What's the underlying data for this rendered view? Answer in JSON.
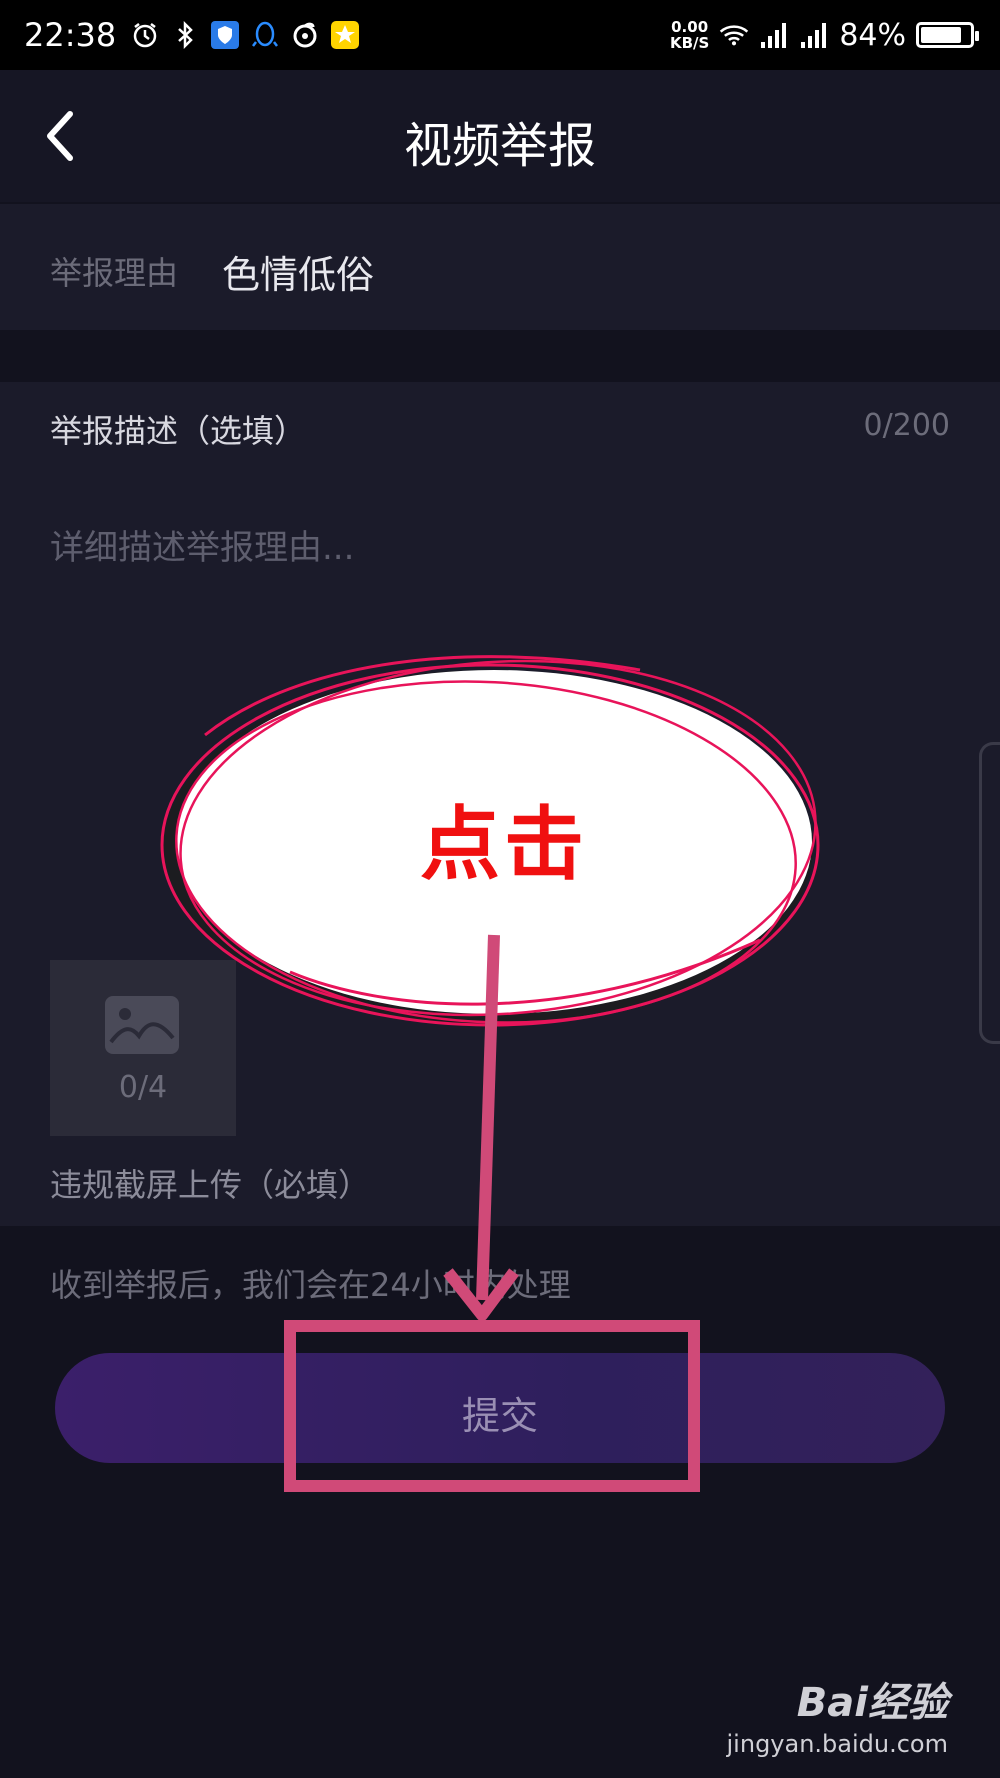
{
  "status_bar": {
    "time": "22:38",
    "net_speed_value": "0.00",
    "net_speed_unit": "KB/S",
    "battery_text": "84%",
    "battery_level": 0.84,
    "icons": [
      "alarm-icon",
      "bluetooth-icon",
      "shield-icon",
      "qq-icon",
      "music-icon",
      "star-icon",
      "wifi-icon",
      "signal-icon",
      "signal-4g-icon",
      "battery-icon"
    ]
  },
  "header": {
    "title": "视频举报",
    "back_icon": "chevron-left-icon"
  },
  "reason": {
    "label": "举报理由",
    "value": "色情低俗"
  },
  "description": {
    "label": "举报描述（选填）",
    "counter": "0/200",
    "placeholder": "详细描述举报理由..."
  },
  "upload": {
    "count": "0/4",
    "label": "违规截屏上传（必填）",
    "icon": "image-icon"
  },
  "note": "收到举报后，我们会在24小时内处理",
  "submit": {
    "label": "提交"
  },
  "annotation": {
    "callout_text": "点击"
  },
  "watermark": {
    "brand": "Bai经验",
    "url": "jingyan.baidu.com"
  },
  "colors": {
    "background": "#12121e",
    "panel": "#1b1b2a",
    "submit_gradient_start": "#3b1f6a",
    "annotation_red": "#f01010",
    "annotation_pink": "#d04a78"
  }
}
